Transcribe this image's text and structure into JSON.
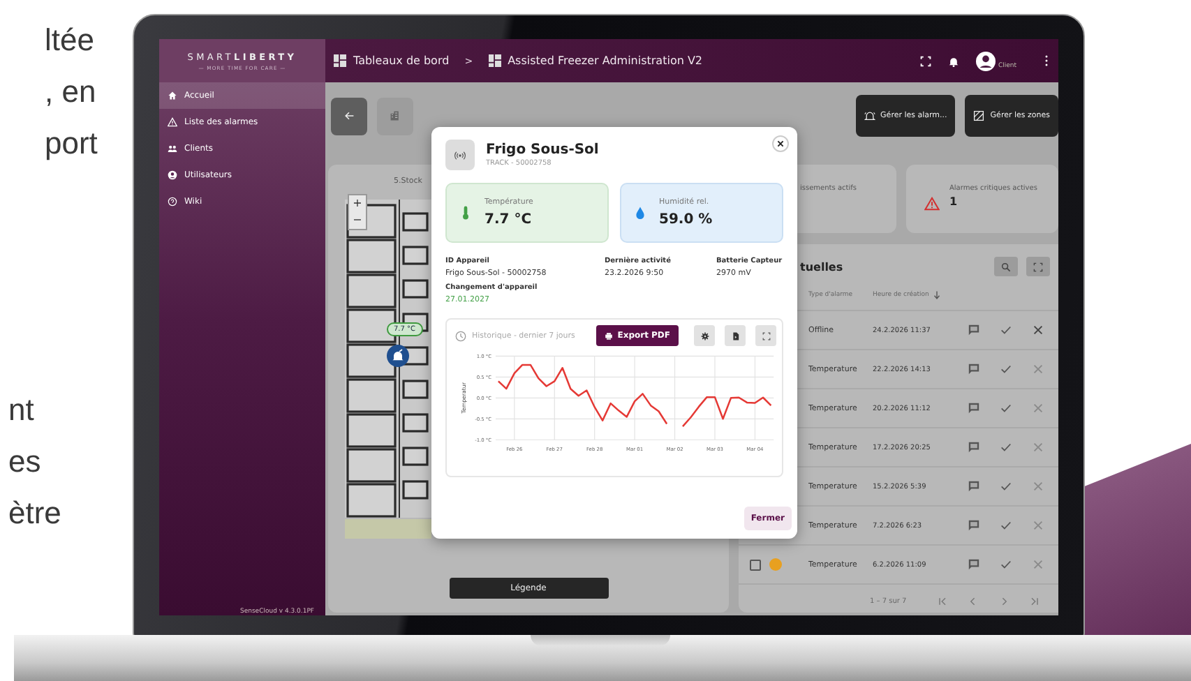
{
  "marketing_text": {
    "upper": [
      "ltée",
      ", en",
      "port"
    ],
    "lower": [
      "nt",
      "es",
      "ètre"
    ]
  },
  "app": {
    "logo": {
      "brand_light": "SMART",
      "brand_bold": "LIBERTY",
      "tagline": "— MORE TIME FOR CARE —"
    },
    "breadcrumb": [
      {
        "label": "Tableaux de bord"
      },
      {
        "label": "Assisted Freezer Administration V2"
      }
    ],
    "breadcrumb_separator": ">",
    "user": {
      "name": "Client"
    },
    "sidebar": {
      "items": [
        {
          "label": "Accueil",
          "selected": true
        },
        {
          "label": "Liste des alarmes",
          "selected": false
        },
        {
          "label": "Clients",
          "selected": false
        },
        {
          "label": "Utilisateurs",
          "selected": false
        },
        {
          "label": "Wiki",
          "selected": false
        }
      ],
      "footer": "SenseCloud v 4.3.0.1PF"
    },
    "toolbar": {
      "actions": [
        {
          "label": "Gérer les alarm..."
        },
        {
          "label": "Gérer les zones"
        }
      ]
    },
    "floor_plan": {
      "title": "5.Stock",
      "zoom_in": "+",
      "zoom_out": "−",
      "sensor_label": "7.7 °C",
      "legend_button": "Légende"
    },
    "stats": [
      {
        "label": "issements actifs"
      },
      {
        "label": "Alarmes critiques actives",
        "value": "1"
      }
    ],
    "alarms": {
      "title": "tuelles",
      "columns": [
        "Type d'alarme",
        "Heure de création"
      ],
      "rows": [
        {
          "type": "Offline",
          "time": "24.2.2026 11:37",
          "close_enabled": true
        },
        {
          "type": "Temperature",
          "time": "22.2.2026 14:13",
          "close_enabled": false
        },
        {
          "type": "Temperature",
          "time": "20.2.2026 11:12",
          "close_enabled": false
        },
        {
          "type": "Temperature",
          "time": "17.2.2026 20:25",
          "close_enabled": false
        },
        {
          "type": "Temperature",
          "time": "15.2.2026 5:39",
          "close_enabled": false
        },
        {
          "type": "Temperature",
          "time": "7.2.2026 6:23",
          "close_enabled": false
        },
        {
          "type": "Temperature",
          "time": "6.2.2026 11:09",
          "close_enabled": false,
          "checked": false,
          "color": "#e8a020"
        }
      ],
      "pagination": "1 – 7 sur 7"
    },
    "modal": {
      "title": "Frigo Sous-Sol",
      "subtitle": "TRACK - 50002758",
      "measurements": [
        {
          "kind": "temperature",
          "label": "Température",
          "value": "7.7 °C"
        },
        {
          "kind": "humidity",
          "label": "Humidité rel.",
          "value": "59.0 %"
        }
      ],
      "details": [
        {
          "label": "ID Appareil",
          "value": "Frigo Sous-Sol - 50002758",
          "color": "#333333"
        },
        {
          "label": "Dernière activité",
          "value": "23.2.2026 9:50",
          "color": "#333333"
        },
        {
          "label": "Batterie Capteur",
          "value": "2970 mV",
          "color": "#333333"
        },
        {
          "label": "Changement d'appareil",
          "value": "27.01.2027",
          "color": "#43a047"
        }
      ],
      "history": {
        "title": "Historique - dernier 7 jours",
        "export_button": "Export PDF",
        "chart_data": {
          "type": "line",
          "grid": true,
          "ylabel": "Temperatur",
          "categories": [
            null,
            null,
            "Feb 26",
            null,
            null,
            null,
            null,
            "Feb 27",
            null,
            null,
            null,
            null,
            "Feb 28",
            null,
            null,
            null,
            null,
            "Mar 01",
            null,
            null,
            null,
            null,
            "Mar 02",
            null,
            null,
            null,
            null,
            "Mar 03",
            null,
            null,
            null,
            null,
            "Mar 04",
            null,
            null
          ],
          "series": [
            {
              "color": "#e53935",
              "values": [
                0.4,
                0.22,
                0.59,
                0.79,
                0.79,
                0.47,
                0.28,
                0.4,
                0.72,
                0.22,
                0.05,
                0.18,
                -0.22,
                -0.54,
                -0.13,
                -0.3,
                -0.45,
                -0.08,
                0.1,
                -0.18,
                -0.32,
                -0.62,
                null,
                -0.68,
                -0.46,
                -0.21,
                0.02,
                0.02,
                -0.5,
                0.0,
                0.01,
                -0.11,
                -0.12,
                0.01,
                -0.18
              ]
            }
          ],
          "ylim": [
            -1,
            1
          ],
          "yticks": [
            {
              "value": -1,
              "label": "-1.0 °C"
            },
            {
              "value": -0.5,
              "label": "-0.5 °C"
            },
            {
              "value": 0,
              "label": "0.0 °C"
            },
            {
              "value": 0.5,
              "label": "0.5 °C"
            },
            {
              "value": 1,
              "label": "1.0 °C"
            }
          ]
        }
      },
      "close_button": "Fermer"
    }
  }
}
